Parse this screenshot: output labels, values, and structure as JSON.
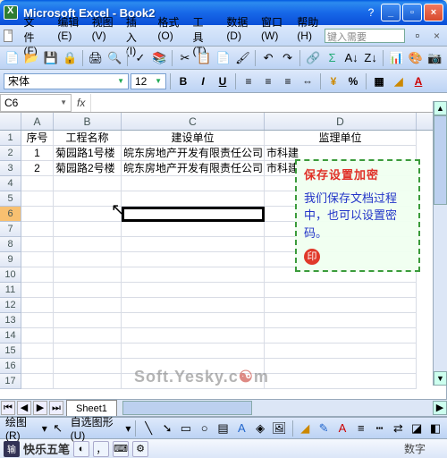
{
  "window": {
    "title": "Microsoft Excel - Book2"
  },
  "menu": {
    "file": "文件(F)",
    "edit": "编辑(E)",
    "view": "视图(V)",
    "insert": "插入(I)",
    "format": "格式(O)",
    "tools": "工具(T)",
    "data": "数据(D)",
    "window": "窗口(W)",
    "help": "帮助(H)",
    "ask": "键入需要"
  },
  "format_bar": {
    "font": "宋体",
    "size": "12"
  },
  "namebox": {
    "ref": "C6"
  },
  "columns": {
    "A": "A",
    "B": "B",
    "C": "C",
    "D": "D"
  },
  "headers": {
    "A": "序号",
    "B": "工程名称",
    "C": "建设单位",
    "D": "监理单位"
  },
  "rows": [
    {
      "A": "1",
      "B": "菊园路1号楼",
      "C": "皖东房地产开发有限责任公司",
      "D": "市科建"
    },
    {
      "A": "2",
      "B": "菊园路2号楼",
      "C": "皖东房地产开发有限责任公司",
      "D": "市科建"
    }
  ],
  "callout": {
    "title": "保存设置加密",
    "body": "我们保存文档过程中，也可以设置密码。",
    "stamp": "印"
  },
  "watermark": {
    "t1": "Soft.Yesky.c",
    "t2": "m"
  },
  "sheet": {
    "name": "Sheet1"
  },
  "drawbar": {
    "label": "绘图(R)",
    "autoshape": "自选图形(U)"
  },
  "ime": {
    "name": "快乐五笔"
  },
  "status": {
    "num": "数字"
  }
}
